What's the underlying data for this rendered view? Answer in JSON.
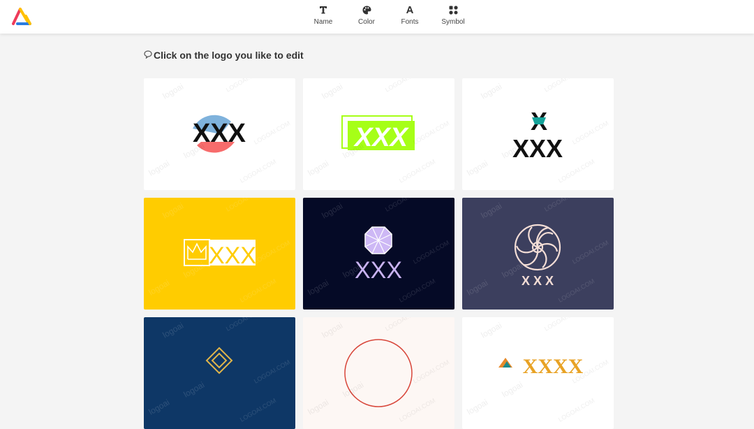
{
  "nav": {
    "items": [
      {
        "label": "Name",
        "icon": "text-t-icon"
      },
      {
        "label": "Color",
        "icon": "palette-icon"
      },
      {
        "label": "Fonts",
        "icon": "font-a-icon"
      },
      {
        "label": "Symbol",
        "icon": "shapes-icon"
      }
    ]
  },
  "main": {
    "title_icon": "chat-bubble-icon",
    "title": "Click on the logo you like to edit"
  },
  "watermark": {
    "brand": "logoai",
    "domain": "LOGOAI.COM"
  },
  "logos": [
    {
      "text": "XXX",
      "bg": "#ffffff",
      "style": "circle-split"
    },
    {
      "text": "XXX",
      "bg": "#ffffff",
      "style": "lime-banner"
    },
    {
      "text": "XXX",
      "symbol_text": "X",
      "bg": "#ffffff",
      "style": "teal-x-stack"
    },
    {
      "text": "XXX",
      "bg": "#ffcc00",
      "style": "crown-box"
    },
    {
      "text": "XXX",
      "bg": "#050a26",
      "style": "octagon-gem"
    },
    {
      "text": "X X X",
      "bg": "#3c3f5e",
      "style": "spiral-flower"
    },
    {
      "text": "",
      "bg": "#0e3766",
      "style": "diamond-frame"
    },
    {
      "text": "",
      "bg": "#fdf7f4",
      "style": "red-circle"
    },
    {
      "text": "XXXX",
      "bg": "#ffffff",
      "style": "orange-pyramid"
    }
  ],
  "colors": {
    "accent_red": "#ee3b5a",
    "accent_yellow": "#ffc000",
    "accent_blue": "#2a7de1"
  }
}
